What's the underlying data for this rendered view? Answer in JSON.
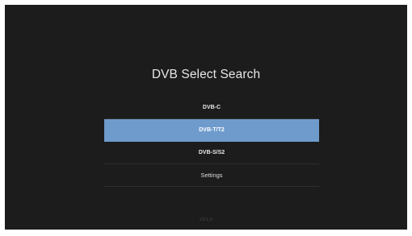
{
  "screen": {
    "title": "DVB Select Search",
    "version": "V3.1.0"
  },
  "menu": {
    "items": [
      {
        "label": "DVB-C",
        "selected": false
      },
      {
        "label": "DVB-T/T2",
        "selected": true
      },
      {
        "label": "DVB-S/S2",
        "selected": false
      },
      {
        "label": "Settings",
        "selected": false
      }
    ]
  },
  "colors": {
    "background": "#1c1c1c",
    "highlight": "#6e9bcc",
    "text": "#e6e6e6"
  }
}
